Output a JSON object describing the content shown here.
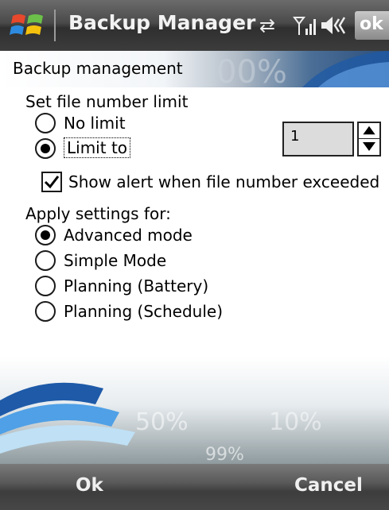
{
  "titlebar": {
    "title": "Backup Manager",
    "ok_label": "ok",
    "icons": [
      "windows-start-icon",
      "connectivity-icon",
      "signal-icon",
      "volume-icon"
    ]
  },
  "content": {
    "header_title": "Backup management",
    "file_limit_label": "Set file number limit",
    "no_limit_label": "No limit",
    "limit_to_label": "Limit to",
    "limit_value": "1",
    "alert_label": "Show alert when file number exceeded",
    "apply_label": "Apply settings for:",
    "modes": [
      "Advanced mode",
      "Simple Mode",
      "Planning (Battery)",
      "Planning (Schedule)"
    ],
    "selected_mode": "Advanced mode",
    "limit_selected": "Limit to",
    "alert_checked": true
  },
  "softkeys": {
    "left": "Ok",
    "right": "Cancel"
  },
  "colors": {
    "bar_dark": "#3d3d3d",
    "banner_blue": "#2b5ea8",
    "text": "#000000"
  }
}
